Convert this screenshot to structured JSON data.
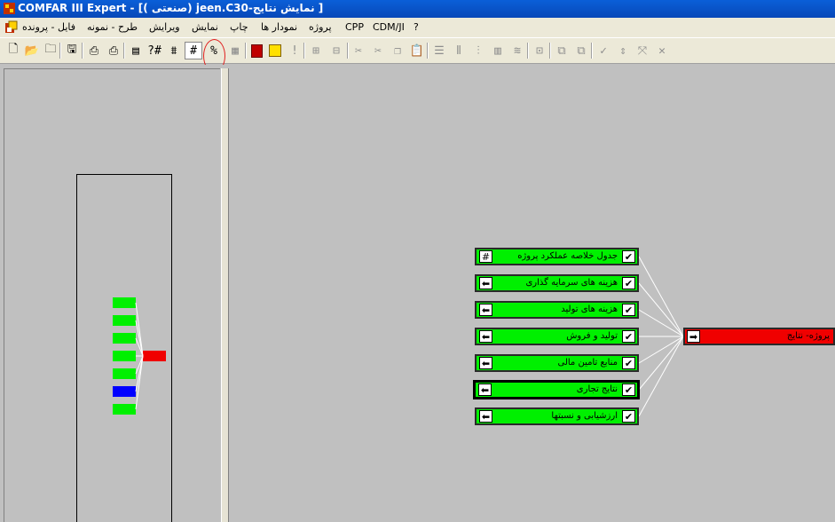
{
  "window": {
    "title": "COMFAR III Expert - [( صنعتی) jeen.C30-نمایش نتایج ]"
  },
  "menubar": {
    "items": [
      "فایل - پرونده",
      "طرح - نمونه",
      "ویرایش",
      "نمایش",
      "چاپ",
      "نمودار ها",
      "پروژه",
      "CPP",
      "CDM/JI",
      "?"
    ]
  },
  "toolbar": {
    "icons": [
      "new-file-icon",
      "open-folder-icon",
      "open-icon",
      "save-icon",
      "print-icon",
      "print-setup-icon",
      "table-icon",
      "help-number-icon",
      "number-format-icon",
      "hash-icon",
      "percent-hash-icon",
      "grid-icon",
      "calculator-icon",
      "note-icon",
      "exclamation-icon",
      "tree-expand-icon",
      "tree-collapse-icon",
      "cut-icon",
      "cut-percent-icon",
      "copy-icon",
      "paste-icon",
      "rows-icon",
      "columns-icon",
      "bar-columns-icon",
      "column-chart-icon",
      "wave-icon",
      "insert-icon",
      "copy-block-icon",
      "move-block-icon",
      "check-down-icon",
      "expand-icon",
      "collapse-icon",
      "close-x-icon"
    ]
  },
  "tree": {
    "root": {
      "label": "پروژه- نتایج",
      "button": "➡",
      "color": "#f00000"
    },
    "children": [
      {
        "label": "جدول خلاصه عملکرد پروژه",
        "button": "#",
        "checked": true,
        "color": "#00f000"
      },
      {
        "label": "هزینه های سرمایه گذاری",
        "button": "⬅",
        "checked": true,
        "color": "#00f000"
      },
      {
        "label": "هزینه های تولید",
        "button": "⬅",
        "checked": true,
        "color": "#00f000"
      },
      {
        "label": "تولید و فروش",
        "button": "⬅",
        "checked": true,
        "color": "#00f000"
      },
      {
        "label": "منابع تامین مالی",
        "button": "⬅",
        "checked": true,
        "color": "#00f000"
      },
      {
        "label": "نتایج تجاری",
        "button": "⬅",
        "checked": true,
        "color": "#00f000",
        "selected": true
      },
      {
        "label": "ارزشیابی و نسبتها",
        "button": "⬅",
        "checked": true,
        "color": "#00f000"
      }
    ]
  },
  "overview": {
    "block_colors": [
      "#00f000",
      "#00f000",
      "#00f000",
      "#00f000",
      "#00f000",
      "#0000ff",
      "#00f000"
    ],
    "root_color": "#f00000"
  }
}
